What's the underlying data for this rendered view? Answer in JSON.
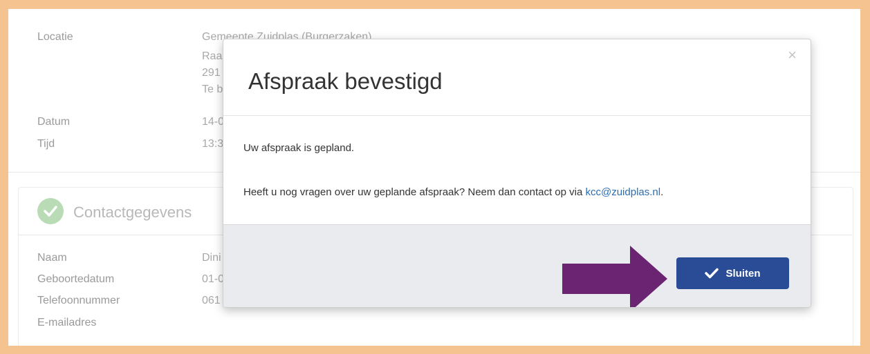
{
  "background": {
    "location": {
      "label": "Locatie",
      "lines": [
        "Gemeente Zuidplas (Burgerzaken)",
        "Raa",
        "291",
        "Te b"
      ]
    },
    "date": {
      "label": "Datum",
      "value": "14-0"
    },
    "time": {
      "label": "Tijd",
      "value": "13:3"
    },
    "contact_section_title": "Contactgegevens",
    "contact": [
      {
        "label": "Naam",
        "value": "Dini"
      },
      {
        "label": "Geboortedatum",
        "value": "01-0"
      },
      {
        "label": "Telefoonnummer",
        "value": "061"
      },
      {
        "label": "E-mailadres",
        "value": ""
      }
    ]
  },
  "modal": {
    "title": "Afspraak bevestigd",
    "close_glyph": "×",
    "body_line1": "Uw afspraak is gepland.",
    "body_line2_prefix": "Heeft u nog vragen over uw geplande afspraak? Neem dan contact op via ",
    "email_link": "kcc@zuidplas.nl",
    "body_line2_suffix": ".",
    "button_label": "Sluiten",
    "button_icon": "checkmark-icon"
  },
  "colors": {
    "frame_border": "#f5c38f",
    "button": "#2a4c96",
    "link": "#2a6db5",
    "arrow": "#6a2471",
    "success": "#b9dcb7"
  }
}
